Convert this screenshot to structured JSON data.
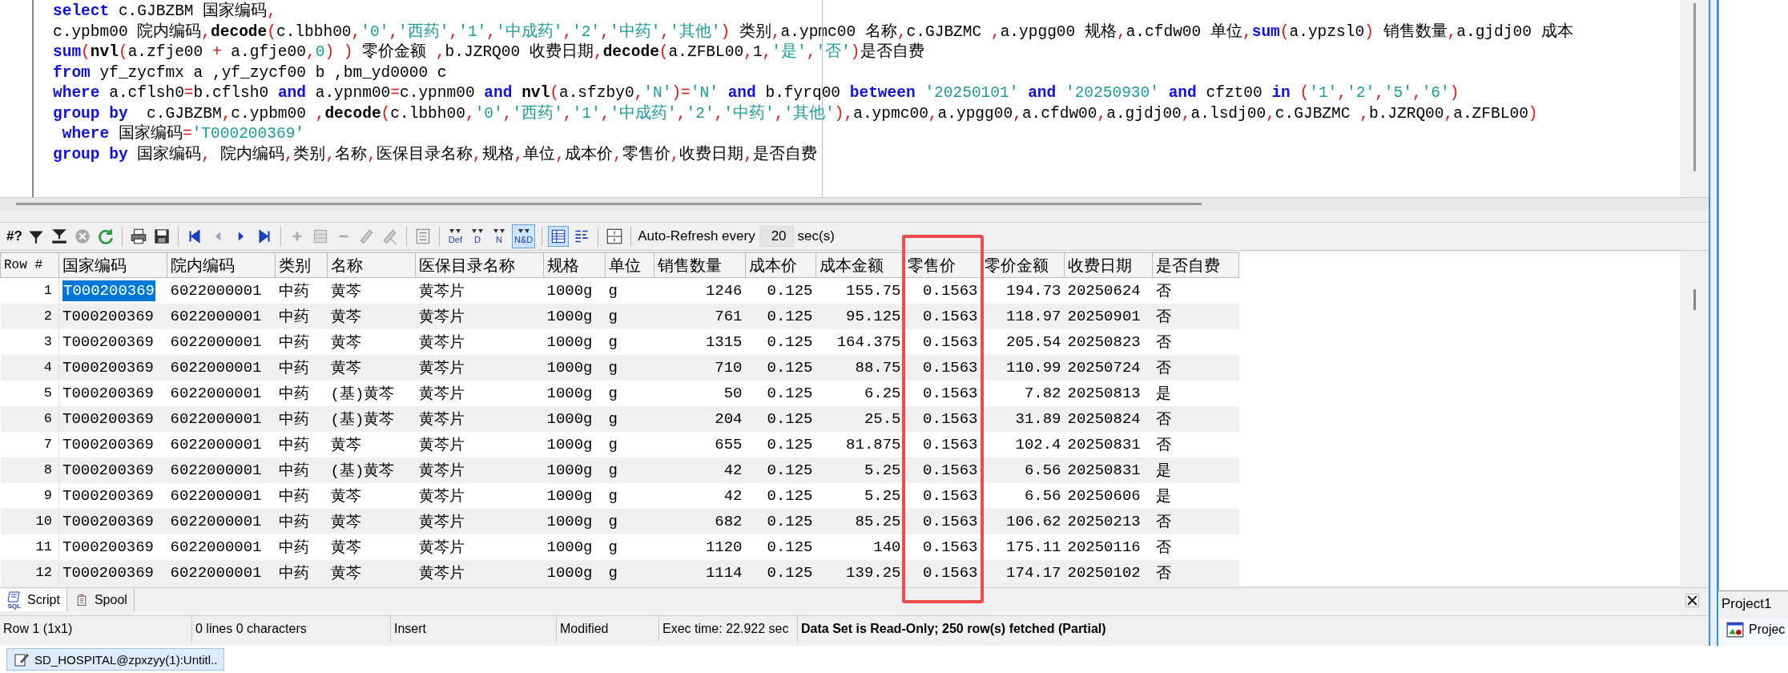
{
  "editor": {
    "lines": [
      [
        {
          "kind": "keyword",
          "text": "select"
        },
        {
          "kind": "plain",
          "text": " c.GJBZBM 国家编码"
        },
        {
          "kind": "symbol",
          "text": ","
        }
      ],
      [
        {
          "kind": "plain",
          "text": "c.ypbm00 院内编码"
        },
        {
          "kind": "symbol",
          "text": ","
        },
        {
          "kind": "function",
          "text": "decode"
        },
        {
          "kind": "symbol",
          "text": "("
        },
        {
          "kind": "plain",
          "text": "c.lbbh00"
        },
        {
          "kind": "symbol",
          "text": ","
        },
        {
          "kind": "string",
          "text": "'0'"
        },
        {
          "kind": "symbol",
          "text": ","
        },
        {
          "kind": "string",
          "text": "'西药'"
        },
        {
          "kind": "symbol",
          "text": ","
        },
        {
          "kind": "string",
          "text": "'1'"
        },
        {
          "kind": "symbol",
          "text": ","
        },
        {
          "kind": "string",
          "text": "'中成药'"
        },
        {
          "kind": "symbol",
          "text": ","
        },
        {
          "kind": "string",
          "text": "'2'"
        },
        {
          "kind": "symbol",
          "text": ","
        },
        {
          "kind": "string",
          "text": "'中药'"
        },
        {
          "kind": "symbol",
          "text": ","
        },
        {
          "kind": "string",
          "text": "'其他'"
        },
        {
          "kind": "symbol",
          "text": ")"
        },
        {
          "kind": "plain",
          "text": " 类别"
        },
        {
          "kind": "symbol",
          "text": ","
        },
        {
          "kind": "plain",
          "text": "a.ypmc00 名称"
        },
        {
          "kind": "symbol",
          "text": ","
        },
        {
          "kind": "plain",
          "text": "c.GJBZMC "
        },
        {
          "kind": "symbol",
          "text": ","
        },
        {
          "kind": "plain",
          "text": "a.ypgg00 规格"
        },
        {
          "kind": "symbol",
          "text": ","
        },
        {
          "kind": "plain",
          "text": "a.cfdw00 单位"
        },
        {
          "kind": "symbol",
          "text": ","
        },
        {
          "kind": "keyword",
          "text": "sum"
        },
        {
          "kind": "symbol",
          "text": "("
        },
        {
          "kind": "plain",
          "text": "a.ypzsl0"
        },
        {
          "kind": "symbol",
          "text": ")"
        },
        {
          "kind": "plain",
          "text": " 销售数量"
        },
        {
          "kind": "symbol",
          "text": ","
        },
        {
          "kind": "plain",
          "text": "a.gjdj00 成本"
        }
      ],
      [
        {
          "kind": "keyword",
          "text": "sum"
        },
        {
          "kind": "symbol",
          "text": "("
        },
        {
          "kind": "function",
          "text": "nvl"
        },
        {
          "kind": "symbol",
          "text": "("
        },
        {
          "kind": "plain",
          "text": "a.zfje00 "
        },
        {
          "kind": "symbol",
          "text": "+"
        },
        {
          "kind": "plain",
          "text": " a.gfje00"
        },
        {
          "kind": "symbol",
          "text": ","
        },
        {
          "kind": "string",
          "text": "0"
        },
        {
          "kind": "symbol",
          "text": ") )"
        },
        {
          "kind": "plain",
          "text": " 零价金额 "
        },
        {
          "kind": "symbol",
          "text": ","
        },
        {
          "kind": "plain",
          "text": "b.JZRQ00 收费日期"
        },
        {
          "kind": "symbol",
          "text": ","
        },
        {
          "kind": "function",
          "text": "decode"
        },
        {
          "kind": "symbol",
          "text": "("
        },
        {
          "kind": "plain",
          "text": "a.ZFBL00"
        },
        {
          "kind": "symbol",
          "text": ","
        },
        {
          "kind": "plain",
          "text": "1"
        },
        {
          "kind": "symbol",
          "text": ","
        },
        {
          "kind": "string",
          "text": "'是'"
        },
        {
          "kind": "symbol",
          "text": ","
        },
        {
          "kind": "string",
          "text": "'否'"
        },
        {
          "kind": "symbol",
          "text": ")"
        },
        {
          "kind": "plain",
          "text": "是否自费"
        }
      ],
      [
        {
          "kind": "keyword",
          "text": "from"
        },
        {
          "kind": "plain",
          "text": " yf_zycfmx a ,yf_zycf00 b ,bm_yd0000 c"
        }
      ],
      [
        {
          "kind": "keyword",
          "text": "where"
        },
        {
          "kind": "plain",
          "text": " a.cflsh0"
        },
        {
          "kind": "symbol",
          "text": "="
        },
        {
          "kind": "plain",
          "text": "b.cflsh0 "
        },
        {
          "kind": "keyword",
          "text": "and"
        },
        {
          "kind": "plain",
          "text": " a.ypnm00"
        },
        {
          "kind": "symbol",
          "text": "="
        },
        {
          "kind": "plain",
          "text": "c.ypnm00 "
        },
        {
          "kind": "keyword",
          "text": "and "
        },
        {
          "kind": "function",
          "text": "nvl"
        },
        {
          "kind": "symbol",
          "text": "("
        },
        {
          "kind": "plain",
          "text": "a.sfzby0"
        },
        {
          "kind": "symbol",
          "text": ","
        },
        {
          "kind": "string",
          "text": "'N'"
        },
        {
          "kind": "symbol",
          "text": ")="
        },
        {
          "kind": "string",
          "text": "'N' "
        },
        {
          "kind": "keyword",
          "text": "and"
        },
        {
          "kind": "plain",
          "text": " b.fyrq00 "
        },
        {
          "kind": "keyword",
          "text": "between "
        },
        {
          "kind": "string",
          "text": "'20250101' "
        },
        {
          "kind": "keyword",
          "text": "and "
        },
        {
          "kind": "string",
          "text": "'20250930' "
        },
        {
          "kind": "keyword",
          "text": "and"
        },
        {
          "kind": "plain",
          "text": " cfzt00 "
        },
        {
          "kind": "keyword",
          "text": "in "
        },
        {
          "kind": "symbol",
          "text": "("
        },
        {
          "kind": "string",
          "text": "'1'"
        },
        {
          "kind": "symbol",
          "text": ","
        },
        {
          "kind": "string",
          "text": "'2'"
        },
        {
          "kind": "symbol",
          "text": ","
        },
        {
          "kind": "string",
          "text": "'5'"
        },
        {
          "kind": "symbol",
          "text": ","
        },
        {
          "kind": "string",
          "text": "'6'"
        },
        {
          "kind": "symbol",
          "text": ")"
        }
      ],
      [
        {
          "kind": "keyword",
          "text": "group by"
        },
        {
          "kind": "plain",
          "text": "  c.GJBZBM"
        },
        {
          "kind": "symbol",
          "text": ","
        },
        {
          "kind": "plain",
          "text": "c.ypbm00 "
        },
        {
          "kind": "symbol",
          "text": ","
        },
        {
          "kind": "function",
          "text": "decode"
        },
        {
          "kind": "symbol",
          "text": "("
        },
        {
          "kind": "plain",
          "text": "c.lbbh00"
        },
        {
          "kind": "symbol",
          "text": ","
        },
        {
          "kind": "string",
          "text": "'0'"
        },
        {
          "kind": "symbol",
          "text": ","
        },
        {
          "kind": "string",
          "text": "'西药'"
        },
        {
          "kind": "symbol",
          "text": ","
        },
        {
          "kind": "string",
          "text": "'1'"
        },
        {
          "kind": "symbol",
          "text": ","
        },
        {
          "kind": "string",
          "text": "'中成药'"
        },
        {
          "kind": "symbol",
          "text": ","
        },
        {
          "kind": "string",
          "text": "'2'"
        },
        {
          "kind": "symbol",
          "text": ","
        },
        {
          "kind": "string",
          "text": "'中药'"
        },
        {
          "kind": "symbol",
          "text": ","
        },
        {
          "kind": "string",
          "text": "'其他'"
        },
        {
          "kind": "symbol",
          "text": "),"
        },
        {
          "kind": "plain",
          "text": "a.ypmc00"
        },
        {
          "kind": "symbol",
          "text": ","
        },
        {
          "kind": "plain",
          "text": "a.ypgg00"
        },
        {
          "kind": "symbol",
          "text": ","
        },
        {
          "kind": "plain",
          "text": "a.cfdw00"
        },
        {
          "kind": "symbol",
          "text": ","
        },
        {
          "kind": "plain",
          "text": "a.gjdj00"
        },
        {
          "kind": "symbol",
          "text": ","
        },
        {
          "kind": "plain",
          "text": "a.lsdj00"
        },
        {
          "kind": "symbol",
          "text": ","
        },
        {
          "kind": "plain",
          "text": "c.GJBZMC "
        },
        {
          "kind": "symbol",
          "text": ","
        },
        {
          "kind": "plain",
          "text": "b.JZRQ00"
        },
        {
          "kind": "symbol",
          "text": ","
        },
        {
          "kind": "plain",
          "text": "a.ZFBL00"
        },
        {
          "kind": "symbol",
          "text": ")"
        }
      ],
      [
        {
          "kind": "keyword",
          "text": " where"
        },
        {
          "kind": "plain",
          "text": " 国家编码"
        },
        {
          "kind": "symbol",
          "text": "="
        },
        {
          "kind": "string",
          "text": "'T000200369'"
        }
      ],
      [
        {
          "kind": "keyword",
          "text": "group by"
        },
        {
          "kind": "plain",
          "text": " 国家编码"
        },
        {
          "kind": "symbol",
          "text": ","
        },
        {
          "kind": "plain",
          "text": " 院内编码"
        },
        {
          "kind": "symbol",
          "text": ","
        },
        {
          "kind": "plain",
          "text": "类别"
        },
        {
          "kind": "symbol",
          "text": ","
        },
        {
          "kind": "plain",
          "text": "名称"
        },
        {
          "kind": "symbol",
          "text": ","
        },
        {
          "kind": "plain",
          "text": "医保目录名称"
        },
        {
          "kind": "symbol",
          "text": ","
        },
        {
          "kind": "plain",
          "text": "规格"
        },
        {
          "kind": "symbol",
          "text": ","
        },
        {
          "kind": "plain",
          "text": "单位"
        },
        {
          "kind": "symbol",
          "text": ","
        },
        {
          "kind": "plain",
          "text": "成本价"
        },
        {
          "kind": "symbol",
          "text": ","
        },
        {
          "kind": "plain",
          "text": "零售价"
        },
        {
          "kind": "symbol",
          "text": ","
        },
        {
          "kind": "plain",
          "text": "收费日期"
        },
        {
          "kind": "symbol",
          "text": ","
        },
        {
          "kind": "plain",
          "text": "是否自费"
        }
      ]
    ]
  },
  "toolbar": {
    "query_label": "#?",
    "filter_buttons": [
      {
        "label": "Def",
        "selected": false
      },
      {
        "label": "D",
        "selected": false
      },
      {
        "label": "N",
        "selected": false
      },
      {
        "label": "N&D",
        "selected": true
      }
    ],
    "view_buttons": [
      {
        "kind": "grid",
        "selected": true
      },
      {
        "kind": "form",
        "selected": false
      }
    ],
    "auto_refresh_label": "Auto-Refresh every",
    "auto_refresh_value": "20",
    "auto_refresh_unit": "sec(s)"
  },
  "grid": {
    "row_header": "Row #",
    "columns": [
      {
        "label": "国家编码",
        "kind": "text",
        "highlighted": false
      },
      {
        "label": "院内编码",
        "kind": "text",
        "highlighted": false
      },
      {
        "label": "类别",
        "kind": "text",
        "highlighted": false
      },
      {
        "label": "名称",
        "kind": "text",
        "highlighted": false
      },
      {
        "label": "医保目录名称",
        "kind": "text",
        "highlighted": false
      },
      {
        "label": "规格",
        "kind": "text",
        "highlighted": false
      },
      {
        "label": "单位",
        "kind": "text",
        "highlighted": false
      },
      {
        "label": "销售数量",
        "kind": "number",
        "highlighted": false
      },
      {
        "label": "成本价",
        "kind": "number",
        "highlighted": false
      },
      {
        "label": "成本金额",
        "kind": "number",
        "highlighted": false
      },
      {
        "label": "零售价",
        "kind": "number",
        "highlighted": true
      },
      {
        "label": "零价金额",
        "kind": "number",
        "highlighted": false
      },
      {
        "label": "收费日期",
        "kind": "text",
        "highlighted": false
      },
      {
        "label": "是否自费",
        "kind": "text",
        "highlighted": false
      }
    ],
    "rows": [
      {
        "row_number": "1",
        "selected": true,
        "cells": [
          "T000200369",
          "6022000001",
          "中药",
          "黄芩",
          "黄芩片",
          "1000g",
          "g",
          "1246",
          "0.125",
          "155.75",
          "0.1563",
          "194.73",
          "20250624",
          "否"
        ]
      },
      {
        "row_number": "2",
        "selected": false,
        "cells": [
          "T000200369",
          "6022000001",
          "中药",
          "黄芩",
          "黄芩片",
          "1000g",
          "g",
          "761",
          "0.125",
          "95.125",
          "0.1563",
          "118.97",
          "20250901",
          "否"
        ]
      },
      {
        "row_number": "3",
        "selected": false,
        "cells": [
          "T000200369",
          "6022000001",
          "中药",
          "黄芩",
          "黄芩片",
          "1000g",
          "g",
          "1315",
          "0.125",
          "164.375",
          "0.1563",
          "205.54",
          "20250823",
          "否"
        ]
      },
      {
        "row_number": "4",
        "selected": false,
        "cells": [
          "T000200369",
          "6022000001",
          "中药",
          "黄芩",
          "黄芩片",
          "1000g",
          "g",
          "710",
          "0.125",
          "88.75",
          "0.1563",
          "110.99",
          "20250724",
          "否"
        ]
      },
      {
        "row_number": "5",
        "selected": false,
        "cells": [
          "T000200369",
          "6022000001",
          "中药",
          "(基)黄芩",
          "黄芩片",
          "1000g",
          "g",
          "50",
          "0.125",
          "6.25",
          "0.1563",
          "7.82",
          "20250813",
          "是"
        ]
      },
      {
        "row_number": "6",
        "selected": false,
        "cells": [
          "T000200369",
          "6022000001",
          "中药",
          "(基)黄芩",
          "黄芩片",
          "1000g",
          "g",
          "204",
          "0.125",
          "25.5",
          "0.1563",
          "31.89",
          "20250824",
          "否"
        ]
      },
      {
        "row_number": "7",
        "selected": false,
        "cells": [
          "T000200369",
          "6022000001",
          "中药",
          "黄芩",
          "黄芩片",
          "1000g",
          "g",
          "655",
          "0.125",
          "81.875",
          "0.1563",
          "102.4",
          "20250831",
          "否"
        ]
      },
      {
        "row_number": "8",
        "selected": false,
        "cells": [
          "T000200369",
          "6022000001",
          "中药",
          "(基)黄芩",
          "黄芩片",
          "1000g",
          "g",
          "42",
          "0.125",
          "5.25",
          "0.1563",
          "6.56",
          "20250831",
          "是"
        ]
      },
      {
        "row_number": "9",
        "selected": false,
        "cells": [
          "T000200369",
          "6022000001",
          "中药",
          "黄芩",
          "黄芩片",
          "1000g",
          "g",
          "42",
          "0.125",
          "5.25",
          "0.1563",
          "6.56",
          "20250606",
          "是"
        ]
      },
      {
        "row_number": "10",
        "selected": false,
        "cells": [
          "T000200369",
          "6022000001",
          "中药",
          "黄芩",
          "黄芩片",
          "1000g",
          "g",
          "682",
          "0.125",
          "85.25",
          "0.1563",
          "106.62",
          "20250213",
          "否"
        ]
      },
      {
        "row_number": "11",
        "selected": false,
        "cells": [
          "T000200369",
          "6022000001",
          "中药",
          "黄芩",
          "黄芩片",
          "1000g",
          "g",
          "1120",
          "0.125",
          "140",
          "0.1563",
          "175.11",
          "20250116",
          "否"
        ]
      },
      {
        "row_number": "12",
        "selected": false,
        "cells": [
          "T000200369",
          "6022000001",
          "中药",
          "黄芩",
          "黄芩片",
          "1000g",
          "g",
          "1114",
          "0.125",
          "139.25",
          "0.1563",
          "174.17",
          "20250102",
          "否"
        ]
      }
    ]
  },
  "bottom_tabs": [
    {
      "label": "Script",
      "icon_label": "SQL",
      "selected": true
    },
    {
      "label": "Spool",
      "selected": false
    }
  ],
  "status_bar": [
    {
      "text": "Row 1 (1x1)",
      "emphasized": false
    },
    {
      "text": "0 lines 0 characters",
      "emphasized": false
    },
    {
      "text": "Insert",
      "emphasized": false
    },
    {
      "text": "Modified",
      "emphasized": false
    },
    {
      "text": "Exec time: 22.922 sec",
      "emphasized": false
    },
    {
      "text": "Data Set is Read-Only; 250 row(s) fetched (Partial)",
      "emphasized": true
    }
  ],
  "side_panel": {
    "title": "Project1",
    "item": "Projec"
  },
  "taskbar": {
    "window": "SD_HOSPITAL@zpxzyy(1):Untitl.."
  }
}
